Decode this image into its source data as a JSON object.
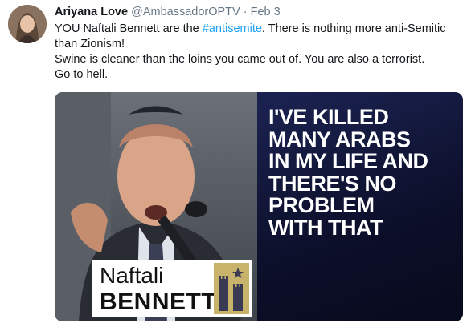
{
  "tweet": {
    "author_name": "Ariyana Love",
    "handle": "@AmbassadorOPTV",
    "separator": "·",
    "timestamp": "Feb 3",
    "line1_pre": "YOU Naftali Bennett are the ",
    "hashtag": "#antisemite",
    "line1_post": ". There is nothing more anti-Semitic than Zionism!",
    "line2": "Swine is cleaner than the loins you came out of. You are also a terrorist.",
    "line3": "Go to hell."
  },
  "media": {
    "quote_lines": [
      "I'VE KILLED",
      "MANY ARABS",
      "IN MY LIFE AND",
      "THERE'S NO",
      "PROBLEM",
      "WITH THAT"
    ],
    "nameplate_first": "Naftali",
    "nameplate_last": "BENNETT"
  },
  "icons": {
    "avatar": "user-avatar",
    "emblem": "party-emblem"
  },
  "colors": {
    "hashtag": "#1da1f2",
    "muted": "#657786",
    "quote_bg": "#0c0f29",
    "emblem": "#c8b36a"
  }
}
